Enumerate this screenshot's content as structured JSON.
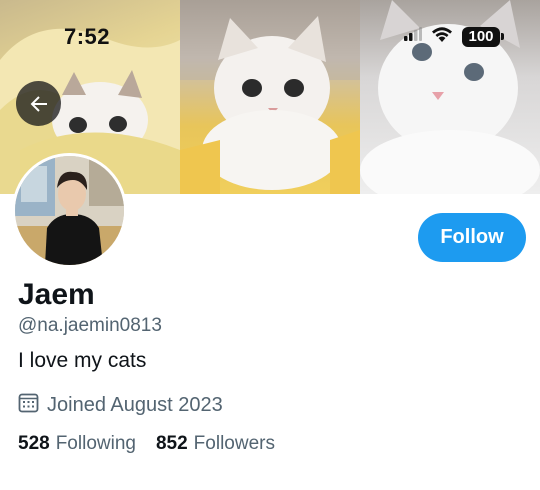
{
  "status_bar": {
    "time": "7:52",
    "battery": "100",
    "icons": [
      "cellular-signal-icon",
      "wifi-icon",
      "battery-icon"
    ]
  },
  "header": {
    "back_icon": "arrow-left-icon",
    "banner_photos": [
      "cat-photo-1",
      "cat-photo-2",
      "cat-photo-3"
    ]
  },
  "profile": {
    "display_name": "Jaem",
    "handle": "@na.jaemin0813",
    "bio": "I love my cats",
    "joined": "Joined August 2023",
    "joined_icon": "calendar-icon",
    "follow_label": "Follow",
    "following_count": "528",
    "following_label": "Following",
    "followers_count": "852",
    "followers_label": "Followers"
  },
  "colors": {
    "accent": "#1d9bf0",
    "text_primary": "#0f1419",
    "text_secondary": "#536471",
    "background": "#ffffff"
  }
}
